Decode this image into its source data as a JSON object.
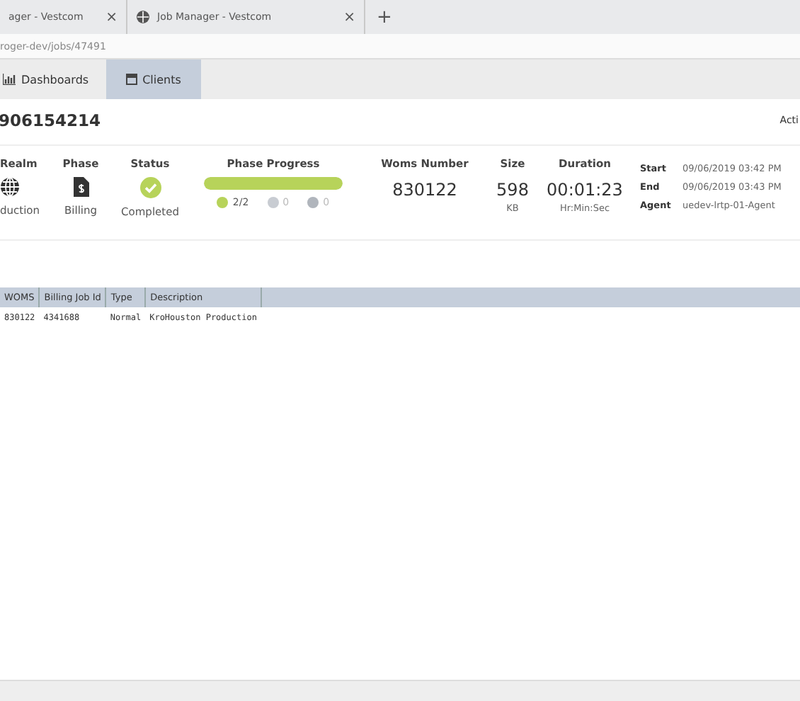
{
  "browser_tabs": [
    {
      "title": "ager - Vestcom",
      "close": "×"
    },
    {
      "title": "Job Manager - Vestcom",
      "close": "×"
    }
  ],
  "new_tab": "+",
  "address": "roger-dev/jobs/47491",
  "nav": [
    {
      "label": "Dashboards",
      "kind": "chart",
      "selected": false
    },
    {
      "label": "Clients",
      "kind": "calendar",
      "selected": true
    }
  ],
  "job_title": "906154214",
  "actions_label": "Acti",
  "summary": {
    "realm": {
      "label": "Realm",
      "value": "duction"
    },
    "phase": {
      "label": "Phase",
      "value": "Billing"
    },
    "status": {
      "label": "Status",
      "value": "Completed"
    },
    "progress": {
      "label": "Phase Progress",
      "level": 1,
      "counts": [
        {
          "kind": "done",
          "text": "2/2"
        },
        {
          "kind": "pending",
          "text": "0"
        },
        {
          "kind": "failed",
          "text": "0"
        }
      ]
    },
    "woms": {
      "label": "Woms Number",
      "value": "830122"
    },
    "size": {
      "label": "Size",
      "value": "598",
      "unit": "KB"
    },
    "duration": {
      "label": "Duration",
      "value": "00:01:23",
      "unit": "Hr:Min:Sec"
    },
    "details": [
      {
        "label": "Start",
        "value": "09/06/2019 03:42 PM"
      },
      {
        "label": "End",
        "value": "09/06/2019 03:43 PM"
      },
      {
        "label": "Agent",
        "value": "uedev-lrtp-01-Agent"
      }
    ]
  },
  "table": {
    "columns": [
      "WOMS",
      "Billing Job Id",
      "Type",
      "Description"
    ],
    "rows": [
      [
        "830122",
        "4341688",
        "Normal",
        "KroHouston Production"
      ]
    ]
  }
}
